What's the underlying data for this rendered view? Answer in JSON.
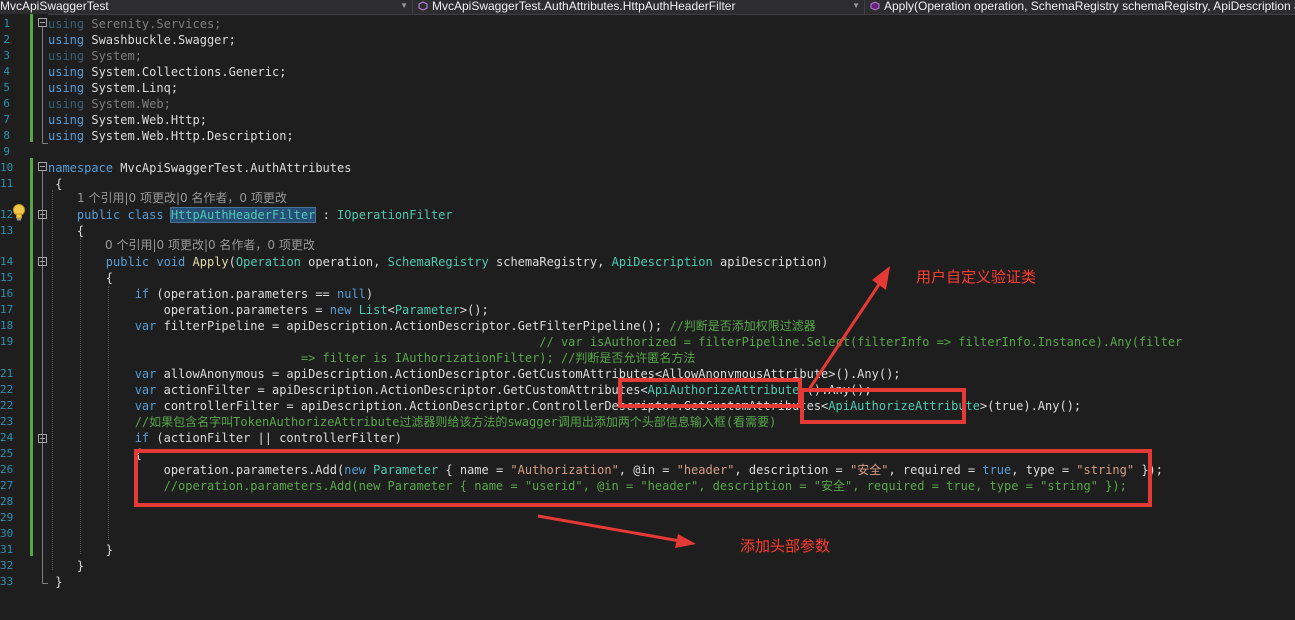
{
  "navbar": {
    "project": "MvcApiSwaggerTest",
    "class": "MvcApiSwaggerTest.AuthAttributes.HttpAuthHeaderFilter",
    "member": "Apply(Operation operation, SchemaRegistry schemaRegistry, ApiDescription apiDescription)"
  },
  "lines": [
    {
      "n": "1",
      "parts": [
        [
          "kw dim",
          "using"
        ],
        [
          "dim",
          " Serenity.Services;"
        ]
      ]
    },
    {
      "n": "2",
      "parts": [
        [
          "kw",
          "using"
        ],
        [
          "",
          " Swashbuckle.Swagger;"
        ]
      ]
    },
    {
      "n": "3",
      "parts": [
        [
          "kw dim",
          "using"
        ],
        [
          "dim",
          " System;"
        ]
      ]
    },
    {
      "n": "4",
      "parts": [
        [
          "kw",
          "using"
        ],
        [
          "",
          " System.Collections.Generic;"
        ]
      ]
    },
    {
      "n": "5",
      "parts": [
        [
          "kw",
          "using"
        ],
        [
          "",
          " System.Linq;"
        ]
      ]
    },
    {
      "n": "6",
      "parts": [
        [
          "kw dim",
          "using"
        ],
        [
          "dim",
          " System.Web;"
        ]
      ]
    },
    {
      "n": "7",
      "parts": [
        [
          "kw",
          "using"
        ],
        [
          "",
          " System.Web.Http;"
        ]
      ]
    },
    {
      "n": "8",
      "parts": [
        [
          "kw",
          "using"
        ],
        [
          "",
          " System.Web.Http.Description;"
        ]
      ]
    },
    {
      "n": "9",
      "parts": []
    },
    {
      "n": "10",
      "parts": [
        [
          "kw",
          "namespace"
        ],
        [
          "",
          " MvcApiSwaggerTest.AuthAttributes"
        ]
      ]
    },
    {
      "n": "11",
      "parts": [
        [
          "",
          " {"
        ]
      ]
    },
    {
      "n": "12",
      "parts": [
        [
          "",
          "    "
        ],
        [
          "kw",
          "public class"
        ],
        [
          "",
          " "
        ],
        [
          "ty hl",
          "HttpAuthHeaderFilter"
        ],
        [
          "",
          " : "
        ],
        [
          "ty",
          "IOperationFilter"
        ]
      ]
    },
    {
      "n": "13",
      "parts": [
        [
          "",
          "    {"
        ]
      ]
    },
    {
      "n": "14",
      "parts": [
        [
          "",
          "        "
        ],
        [
          "kw",
          "public void"
        ],
        [
          "",
          " "
        ],
        [
          "fn",
          "Apply"
        ],
        [
          "",
          "("
        ],
        [
          "ty",
          "Operation"
        ],
        [
          "",
          " operation, "
        ],
        [
          "ty",
          "SchemaRegistry"
        ],
        [
          "",
          " schemaRegistry, "
        ],
        [
          "ty",
          "ApiDescription"
        ],
        [
          "",
          " apiDescription)"
        ]
      ]
    },
    {
      "n": "15",
      "parts": [
        [
          "",
          "        {"
        ]
      ]
    },
    {
      "n": "16",
      "parts": [
        [
          "",
          "            "
        ],
        [
          "kw",
          "if"
        ],
        [
          "",
          " (operation.parameters == "
        ],
        [
          "kw",
          "null"
        ],
        [
          "",
          ")"
        ]
      ]
    },
    {
      "n": "17",
      "parts": [
        [
          "",
          "                operation.parameters = "
        ],
        [
          "kw",
          "new"
        ],
        [
          "",
          " "
        ],
        [
          "ty",
          "List"
        ],
        [
          "",
          "<"
        ],
        [
          "ty",
          "Parameter"
        ],
        [
          "",
          ">();"
        ]
      ]
    },
    {
      "n": "18",
      "parts": [
        [
          "",
          "            "
        ],
        [
          "kw",
          "var"
        ],
        [
          "",
          " filterPipeline = apiDescription.ActionDescriptor.GetFilterPipeline(); "
        ],
        [
          "cm",
          "//判断是否添加权限过滤器"
        ]
      ]
    },
    {
      "n": "19",
      "parts": [
        [
          "",
          "                                                                    "
        ],
        [
          "cm",
          "// var isAuthorized = filterPipeline.Select(filterInfo => filterInfo.Instance).Any(filter"
        ]
      ]
    },
    {
      "n": "19b",
      "parts": [
        [
          "",
          "                                   "
        ],
        [
          "cm",
          "=> filter is IAuthorizationFilter); //判断是否允许匿名方法"
        ]
      ]
    },
    {
      "n": "21",
      "parts": [
        [
          "",
          "            "
        ],
        [
          "kw",
          "var"
        ],
        [
          "",
          " allowAnonymous = apiDescription.ActionDescriptor.GetCustomAttributes<AllowAnonymousAttribute>().Any();"
        ]
      ]
    },
    {
      "n": "22",
      "parts": [
        [
          "",
          "            "
        ],
        [
          "kw",
          "var"
        ],
        [
          "",
          " actionFilter = apiDescription.ActionDescriptor.GetCustomAttributes<"
        ],
        [
          "ty",
          "ApiAuthorizeAttribute"
        ],
        [
          "",
          ">().Any();"
        ]
      ]
    },
    {
      "n": "22b",
      "parts": [
        [
          "",
          "            "
        ],
        [
          "kw",
          "var"
        ],
        [
          "",
          " controllerFilter = apiDescription.ActionDescriptor.ControllerDescriptor.GetCustomAttributes<"
        ],
        [
          "ty",
          "ApiAuthorizeAttribute"
        ],
        [
          "",
          ">(true).Any();"
        ]
      ]
    },
    {
      "n": "23",
      "parts": [
        [
          "",
          "            "
        ],
        [
          "cm",
          "//如果包含名字叫TokenAuthorizeAttribute过滤器则给该方法的swagger调用出添加两个头部信息输入框(看需要)"
        ]
      ]
    },
    {
      "n": "24",
      "parts": [
        [
          "",
          "            "
        ],
        [
          "kw",
          "if"
        ],
        [
          "",
          " (actionFilter || controllerFilter)"
        ]
      ]
    },
    {
      "n": "25",
      "parts": [
        [
          "",
          "            {"
        ]
      ]
    },
    {
      "n": "26",
      "parts": [
        [
          "",
          "                operation.parameters.Add("
        ],
        [
          "kw",
          "new"
        ],
        [
          "",
          " "
        ],
        [
          "ty",
          "Parameter"
        ],
        [
          "",
          " { name = "
        ],
        [
          "str",
          "\"Authorization\""
        ],
        [
          "",
          ", @in = "
        ],
        [
          "str",
          "\"header\""
        ],
        [
          "",
          ", description = "
        ],
        [
          "str",
          "\"安全\""
        ],
        [
          "",
          ", required = "
        ],
        [
          "kw",
          "true"
        ],
        [
          "",
          ", type = "
        ],
        [
          "str",
          "\"string\""
        ],
        [
          "",
          " });"
        ]
      ]
    },
    {
      "n": "27",
      "parts": [
        [
          "",
          "                "
        ],
        [
          "cm",
          "//operation.parameters.Add(new Parameter { name = \"userid\", @in = \"header\", description = \"安全\", required = true, type = \"string\" });"
        ]
      ]
    },
    {
      "n": "28",
      "parts": []
    },
    {
      "n": "29",
      "parts": []
    },
    {
      "n": "30",
      "parts": []
    },
    {
      "n": "31",
      "parts": [
        [
          "",
          "        }"
        ]
      ]
    },
    {
      "n": "32",
      "parts": [
        [
          "",
          "    }"
        ]
      ]
    },
    {
      "n": "33",
      "parts": [
        [
          "",
          " }"
        ]
      ]
    }
  ],
  "codelens": [
    {
      "text": "1 个引用|0 项更改|0 名作者，0 项更改"
    },
    {
      "text": "0 个引用|0 项更改|0 名作者，0 项更改"
    }
  ],
  "annotations": {
    "custom_class_label": "用户自定义验证类",
    "add_header_label": "添加头部参数"
  }
}
